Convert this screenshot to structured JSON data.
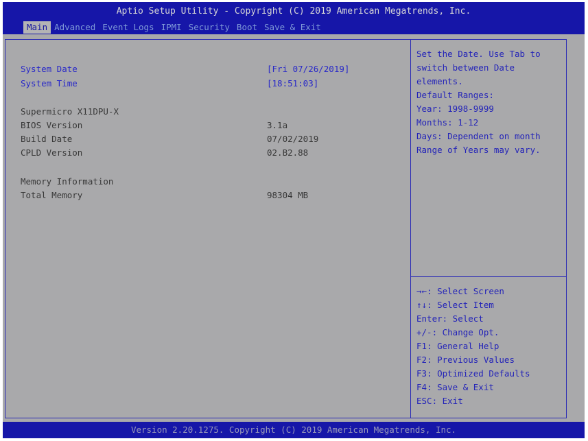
{
  "header": {
    "title": "Aptio Setup Utility - Copyright (C) 2019 American Megatrends, Inc.",
    "tabs": [
      {
        "label": "Main",
        "active": true
      },
      {
        "label": "Advanced",
        "active": false
      },
      {
        "label": "Event Logs",
        "active": false
      },
      {
        "label": "IPMI",
        "active": false
      },
      {
        "label": "Security",
        "active": false
      },
      {
        "label": "Boot",
        "active": false
      },
      {
        "label": "Save & Exit",
        "active": false
      }
    ]
  },
  "main": {
    "system_date_label": "System Date",
    "system_date_value": "[Fri 07/26/2019]",
    "system_time_label": "System Time",
    "system_time_value": "[18:51:03]",
    "board_name": "Supermicro X11DPU-X",
    "bios_version_label": "BIOS Version",
    "bios_version_value": "3.1a",
    "build_date_label": "Build Date",
    "build_date_value": "07/02/2019",
    "cpld_version_label": "CPLD Version",
    "cpld_version_value": "02.B2.88",
    "memory_info_label": "Memory Information",
    "total_memory_label": "Total Memory",
    "total_memory_value": "98304 MB"
  },
  "help": {
    "lines": [
      "Set the Date. Use Tab to",
      "switch between Date",
      "elements.",
      "Default Ranges:",
      "Year: 1998-9999",
      "Months: 1-12",
      "Days: Dependent on month",
      "Range of Years may vary."
    ]
  },
  "keys": {
    "lines": [
      "→←: Select Screen",
      "↑↓: Select Item",
      "Enter: Select",
      "+/-: Change Opt.",
      "F1: General Help",
      "F2: Previous Values",
      "F3: Optimized Defaults",
      "F4: Save & Exit",
      "ESC: Exit"
    ]
  },
  "footer": {
    "text": "Version 2.20.1275. Copyright (C) 2019 American Megatrends, Inc."
  },
  "colors": {
    "title_bar": "#1616a8",
    "background": "#a9a9ab",
    "selected_text": "#2828c8",
    "help_text": "#2424b8"
  }
}
